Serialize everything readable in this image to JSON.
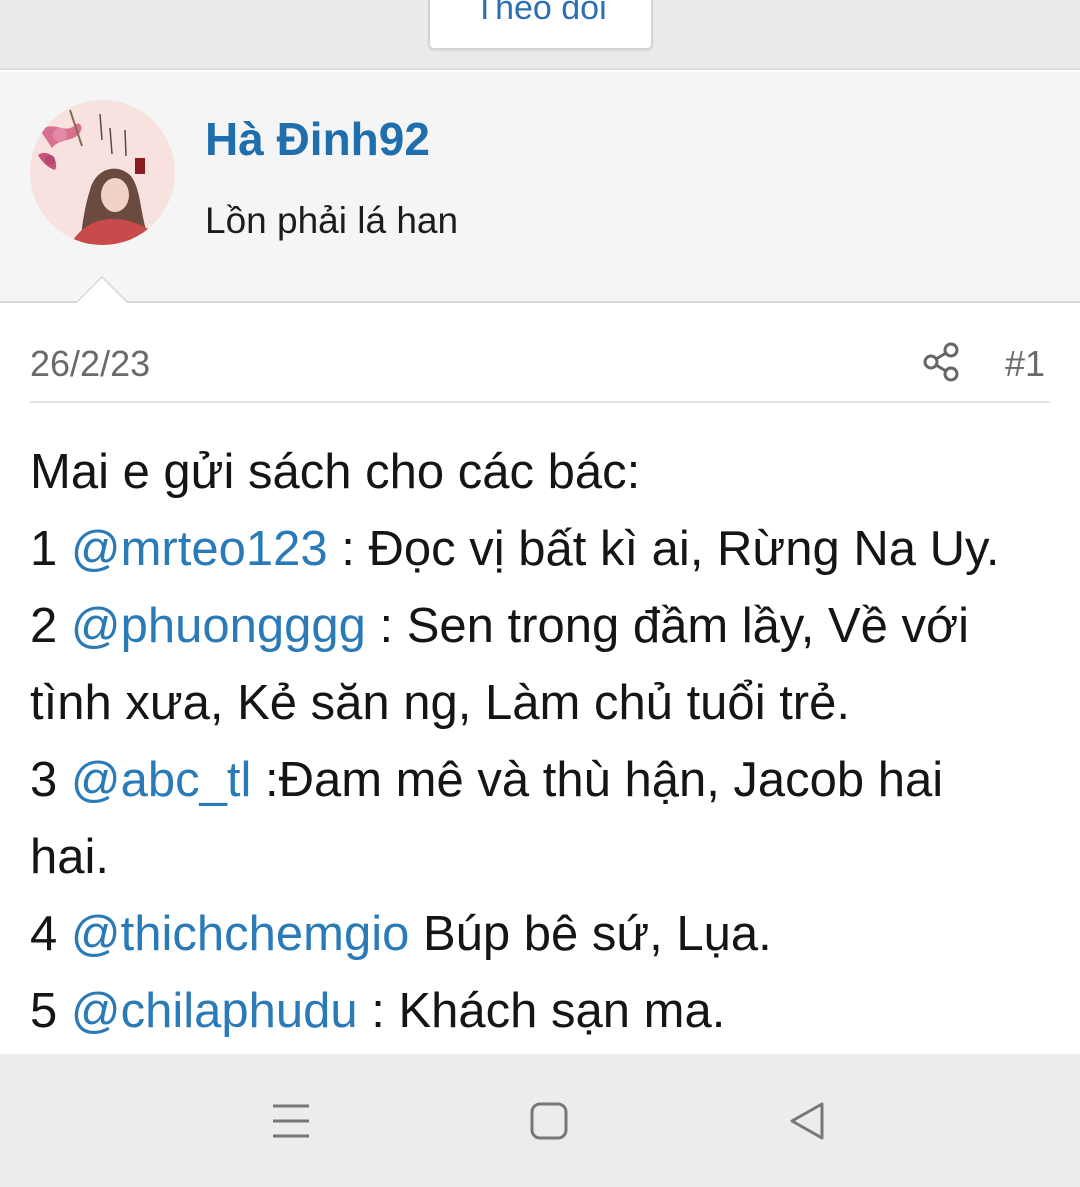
{
  "top": {
    "follow_label": "Theo dõi"
  },
  "user": {
    "name": "Hà Đinh92",
    "title": "Lồn phải lá han"
  },
  "post": {
    "date": "26/2/23",
    "number": "#1",
    "lines": [
      {
        "parts": [
          {
            "text": "Mai e gửi sách cho các bác:",
            "mention": false
          }
        ]
      },
      {
        "parts": [
          {
            "text": "1 ",
            "mention": false
          },
          {
            "text": "@mrteo123",
            "mention": true
          },
          {
            "text": " : Đọc vị bất kì ai, Rừng Na Uy.",
            "mention": false
          }
        ]
      },
      {
        "parts": [
          {
            "text": "2 ",
            "mention": false
          },
          {
            "text": "@phuongggg",
            "mention": true
          },
          {
            "text": " : Sen trong đầm lầy, Về với",
            "mention": false
          }
        ]
      },
      {
        "parts": [
          {
            "text": "tình xưa, Kẻ săn ng, Làm chủ tuổi trẻ.",
            "mention": false
          }
        ]
      },
      {
        "parts": [
          {
            "text": "3 ",
            "mention": false
          },
          {
            "text": "@abc_tl",
            "mention": true
          },
          {
            "text": " :Đam mê và thù hận, Jacob hai",
            "mention": false
          }
        ]
      },
      {
        "parts": [
          {
            "text": "hai.",
            "mention": false
          }
        ]
      },
      {
        "parts": [
          {
            "text": "4 ",
            "mention": false
          },
          {
            "text": "@thichchemgio",
            "mention": true
          },
          {
            "text": " Búp bê sứ, Lụa.",
            "mention": false
          }
        ]
      },
      {
        "parts": [
          {
            "text": "5 ",
            "mention": false
          },
          {
            "text": "@chilaphudu",
            "mention": true
          },
          {
            "text": " : Khách sạn ma.",
            "mention": false
          }
        ]
      }
    ]
  },
  "icons": {
    "share": "share-icon",
    "menu": "menu-icon",
    "home": "home-square-icon",
    "back": "back-triangle-icon"
  },
  "colors": {
    "link": "#1f6fae",
    "mention": "#2a7ab8",
    "header_bg": "#f5f5f5",
    "nav_bg": "#ececec"
  }
}
